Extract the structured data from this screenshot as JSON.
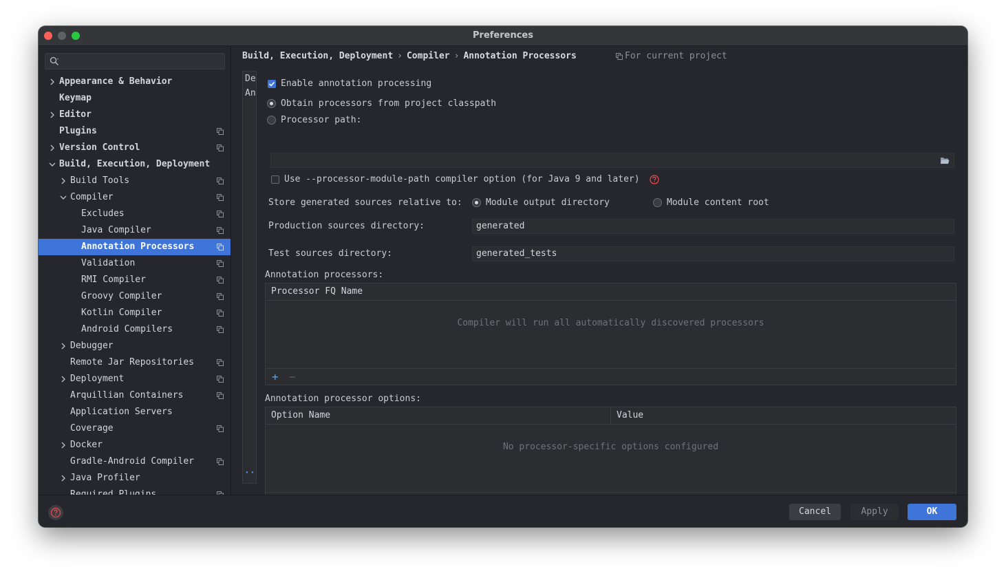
{
  "window": {
    "title": "Preferences"
  },
  "sidebar": {
    "search_placeholder": "",
    "items": [
      {
        "label": "Appearance & Behavior"
      },
      {
        "label": "Keymap"
      },
      {
        "label": "Editor"
      },
      {
        "label": "Plugins"
      },
      {
        "label": "Version Control"
      },
      {
        "label": "Build, Execution, Deployment"
      },
      {
        "label": "Build Tools"
      },
      {
        "label": "Compiler"
      },
      {
        "label": "Excludes"
      },
      {
        "label": "Java Compiler"
      },
      {
        "label": "Annotation Processors"
      },
      {
        "label": "Validation"
      },
      {
        "label": "RMI Compiler"
      },
      {
        "label": "Groovy Compiler"
      },
      {
        "label": "Kotlin Compiler"
      },
      {
        "label": "Android Compilers"
      },
      {
        "label": "Debugger"
      },
      {
        "label": "Remote Jar Repositories"
      },
      {
        "label": "Deployment"
      },
      {
        "label": "Arquillian Containers"
      },
      {
        "label": "Application Servers"
      },
      {
        "label": "Coverage"
      },
      {
        "label": "Docker"
      },
      {
        "label": "Gradle-Android Compiler"
      },
      {
        "label": "Java Profiler"
      },
      {
        "label": "Required Plugins"
      }
    ],
    "selected": "Annotation Processors"
  },
  "breadcrumb": {
    "items": [
      "Build, Execution, Deployment",
      "Compiler",
      "Annotation Processors"
    ],
    "separator": "›",
    "scope": "For current project"
  },
  "profiles": {
    "items": [
      "De",
      "An"
    ],
    "more": "···"
  },
  "settings": {
    "enable_processing": {
      "label": "Enable annotation processing",
      "checked": true
    },
    "obtain_classpath": {
      "label": "Obtain processors from project classpath",
      "selected": true
    },
    "processor_path": {
      "label": "Processor path:",
      "selected": false,
      "value": ""
    },
    "module_path_option": {
      "label": "Use --processor-module-path compiler option (for Java 9 and later)",
      "checked": false
    },
    "store_generated": {
      "label": "Store generated sources relative to:",
      "options": [
        {
          "label": "Module output directory",
          "selected": true
        },
        {
          "label": "Module content root",
          "selected": false
        }
      ]
    },
    "production_dir": {
      "label": "Production sources directory:",
      "value": "generated"
    },
    "test_dir": {
      "label": "Test sources directory:",
      "value": "generated_tests"
    }
  },
  "processors_table": {
    "title": "Annotation processors:",
    "columns": [
      "Processor FQ Name"
    ],
    "empty_text": "Compiler will run all automatically discovered processors",
    "add": "+",
    "remove": "−"
  },
  "options_table": {
    "title": "Annotation processor options:",
    "columns": [
      "Option Name",
      "Value"
    ],
    "empty_text": "No processor-specific options configured",
    "add": "+",
    "remove": "−"
  },
  "buttons": {
    "cancel": "Cancel",
    "apply": "Apply",
    "ok": "OK"
  },
  "colors": {
    "accent": "#3f74d8",
    "background": "#25272c",
    "panel": "#2b2d31",
    "help": "#e5484d"
  },
  "icons": [
    "search-icon",
    "copy-icon",
    "folder-icon",
    "help-icon",
    "chevron-right-icon",
    "chevron-down-icon"
  ]
}
